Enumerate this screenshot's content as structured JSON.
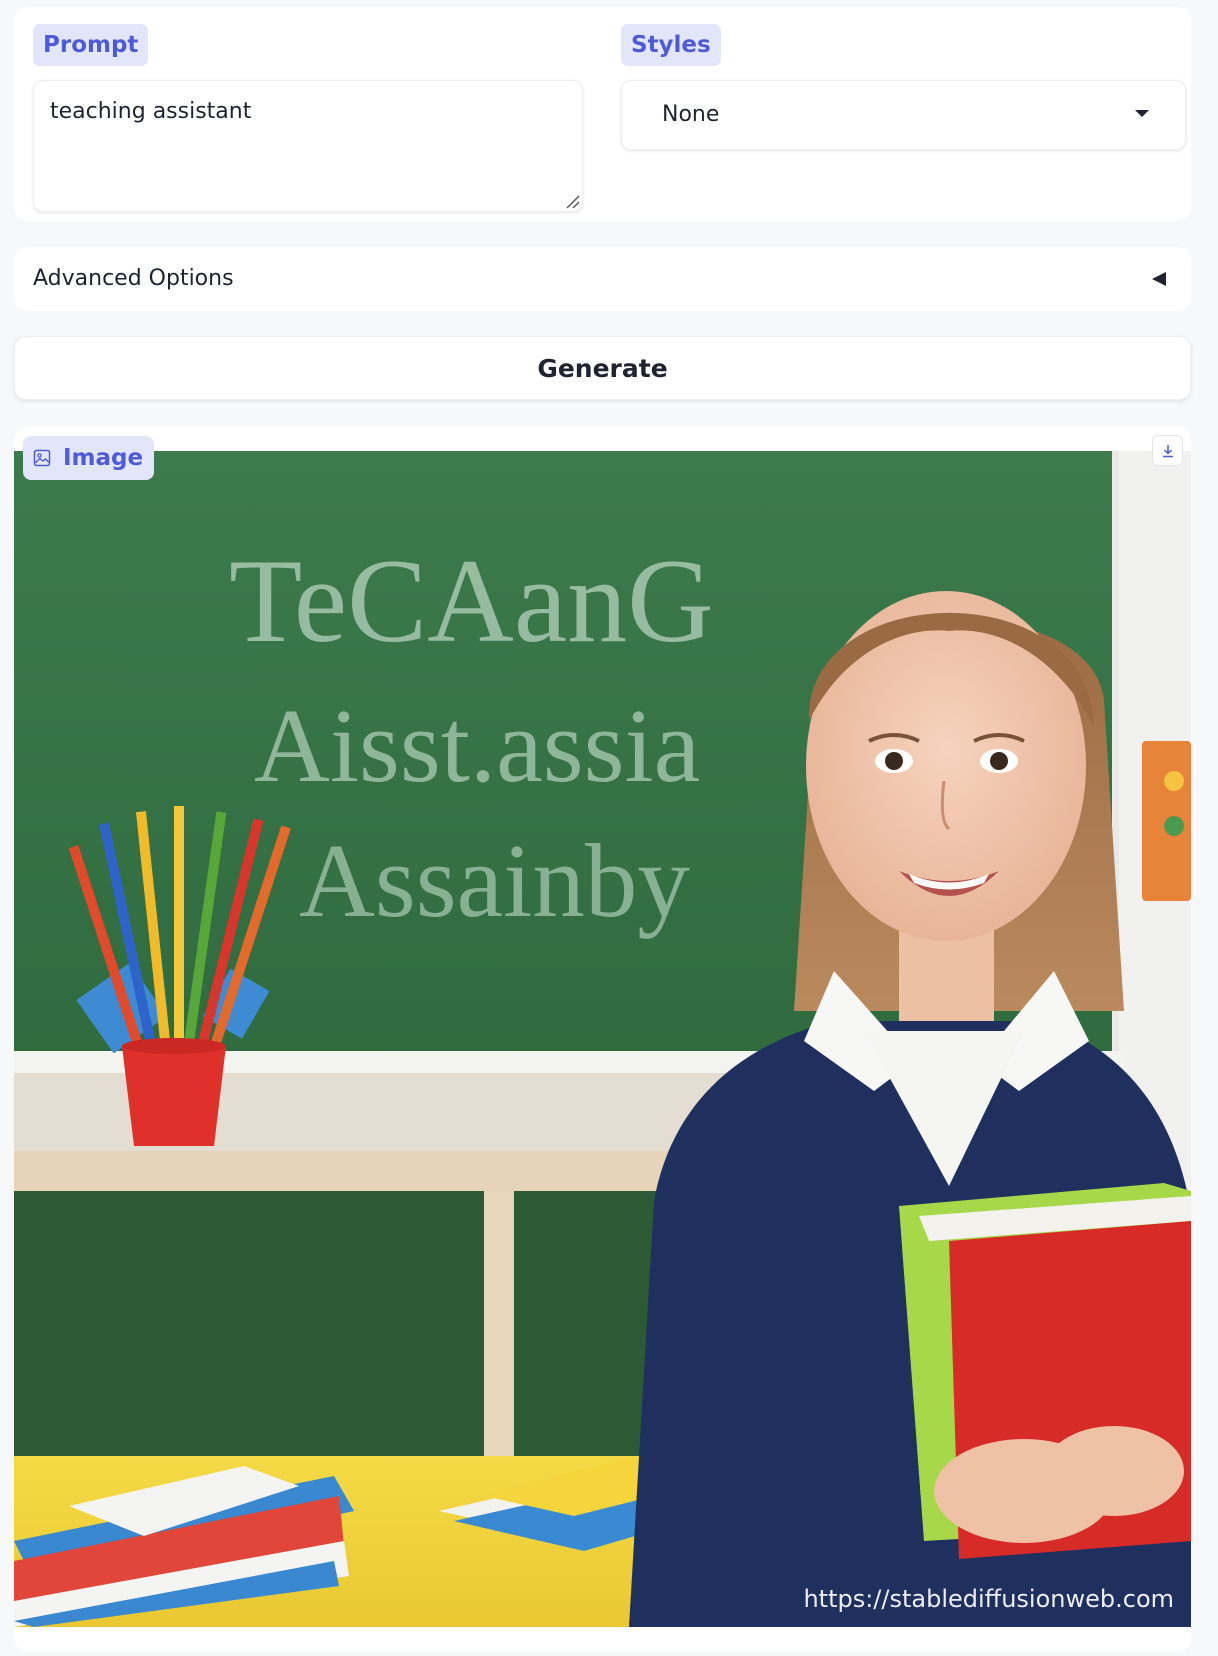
{
  "prompt": {
    "label": "Prompt",
    "value": "teaching assistant"
  },
  "styles": {
    "label": "Styles",
    "selected": "None"
  },
  "advanced_options": {
    "label": "Advanced Options"
  },
  "generate": {
    "label": "Generate"
  },
  "output": {
    "label": "Image",
    "chalkboard_text": [
      "TeCAanG",
      "Aisst.assia",
      "Assainby"
    ],
    "watermark": "https://stablediffusionweb.com"
  },
  "icons": {
    "image_label": "image-icon",
    "download": "download-icon",
    "dropdown": "caret-down-icon",
    "accordion": "caret-left-icon",
    "resize": "resize-grip-icon"
  },
  "colors": {
    "accent": "#4f5bd5",
    "badge_bg": "#e3e6fb",
    "chalkboard": "#3f7f4e",
    "desk": "#f3d63f"
  }
}
